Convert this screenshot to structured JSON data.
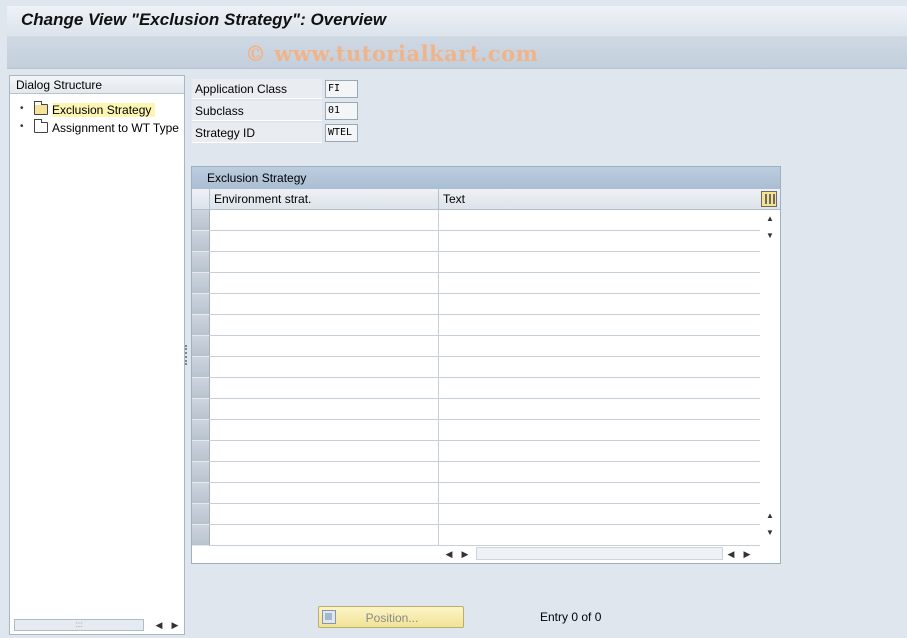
{
  "window": {
    "title": "Change View \"Exclusion Strategy\": Overview",
    "watermark": "© www.tutorialkart.com"
  },
  "dialog_structure": {
    "header": "Dialog Structure",
    "items": [
      {
        "label": "Exclusion Strategy",
        "selected": true,
        "icon": "folder-open-icon"
      },
      {
        "label": "Assignment to WT Type",
        "selected": false,
        "icon": "folder-icon"
      }
    ]
  },
  "fields": [
    {
      "label": "Application Class",
      "value": "FI"
    },
    {
      "label": "Subclass",
      "value": "01"
    },
    {
      "label": "Strategy ID",
      "value": "WTEL"
    }
  ],
  "table": {
    "title": "Exclusion Strategy",
    "columns": [
      "Environment strat.",
      "Text"
    ],
    "rows": [],
    "visible_empty_rows": 16
  },
  "footer": {
    "position_button": "Position...",
    "entry_text": "Entry 0 of 0"
  },
  "colors": {
    "title_bg": "#e7ecf2",
    "selected_item_bg": "#fdf6b3",
    "button_bg": "#f6eaa6"
  }
}
